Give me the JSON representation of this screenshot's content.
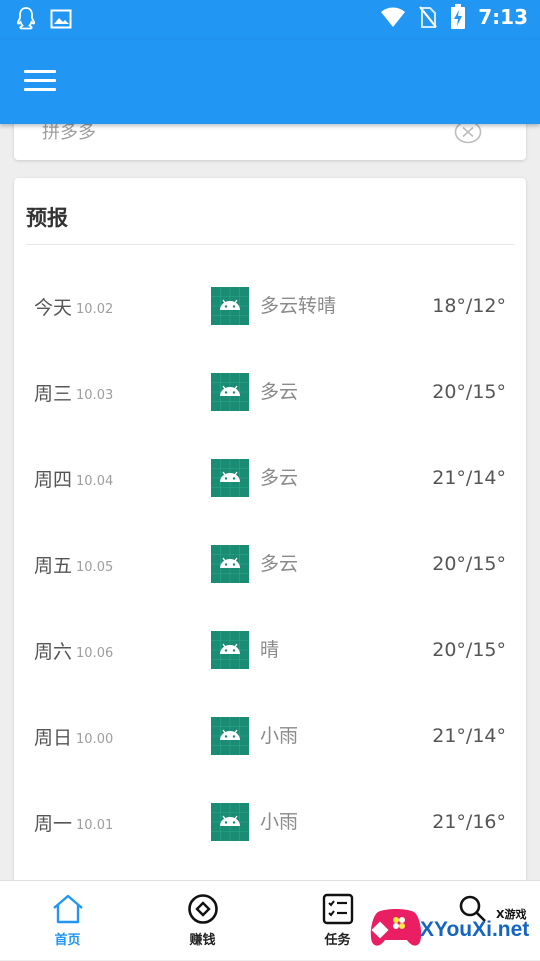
{
  "status_bar": {
    "time": "7:13"
  },
  "search": {
    "value": "拼多多"
  },
  "forecast": {
    "title": "预报",
    "days": [
      {
        "day": "今天",
        "date": "10.02",
        "weather": "多云转晴",
        "temp": "18°/12°"
      },
      {
        "day": "周三",
        "date": "10.03",
        "weather": "多云",
        "temp": "20°/15°"
      },
      {
        "day": "周四",
        "date": "10.04",
        "weather": "多云",
        "temp": "21°/14°"
      },
      {
        "day": "周五",
        "date": "10.05",
        "weather": "多云",
        "temp": "20°/15°"
      },
      {
        "day": "周六",
        "date": "10.06",
        "weather": "晴",
        "temp": "20°/15°"
      },
      {
        "day": "周日",
        "date": "10.00",
        "weather": "小雨",
        "temp": "21°/14°"
      },
      {
        "day": "周一",
        "date": "10.01",
        "weather": "小雨",
        "temp": "21°/16°"
      }
    ]
  },
  "bottom_nav": {
    "items": [
      {
        "label": "首页",
        "icon": "home-icon",
        "active": true
      },
      {
        "label": "赚钱",
        "icon": "target-icon",
        "active": false
      },
      {
        "label": "任务",
        "icon": "checklist-icon",
        "active": false
      },
      {
        "label": "",
        "icon": "search-icon",
        "active": false
      }
    ]
  },
  "watermark": {
    "top": "X游戏",
    "main": "XYouXi.net"
  },
  "colors": {
    "primary": "#2196f3",
    "weather_icon_bg": "#1b8c74",
    "text_primary": "#555555",
    "text_secondary": "#9e9e9e"
  }
}
